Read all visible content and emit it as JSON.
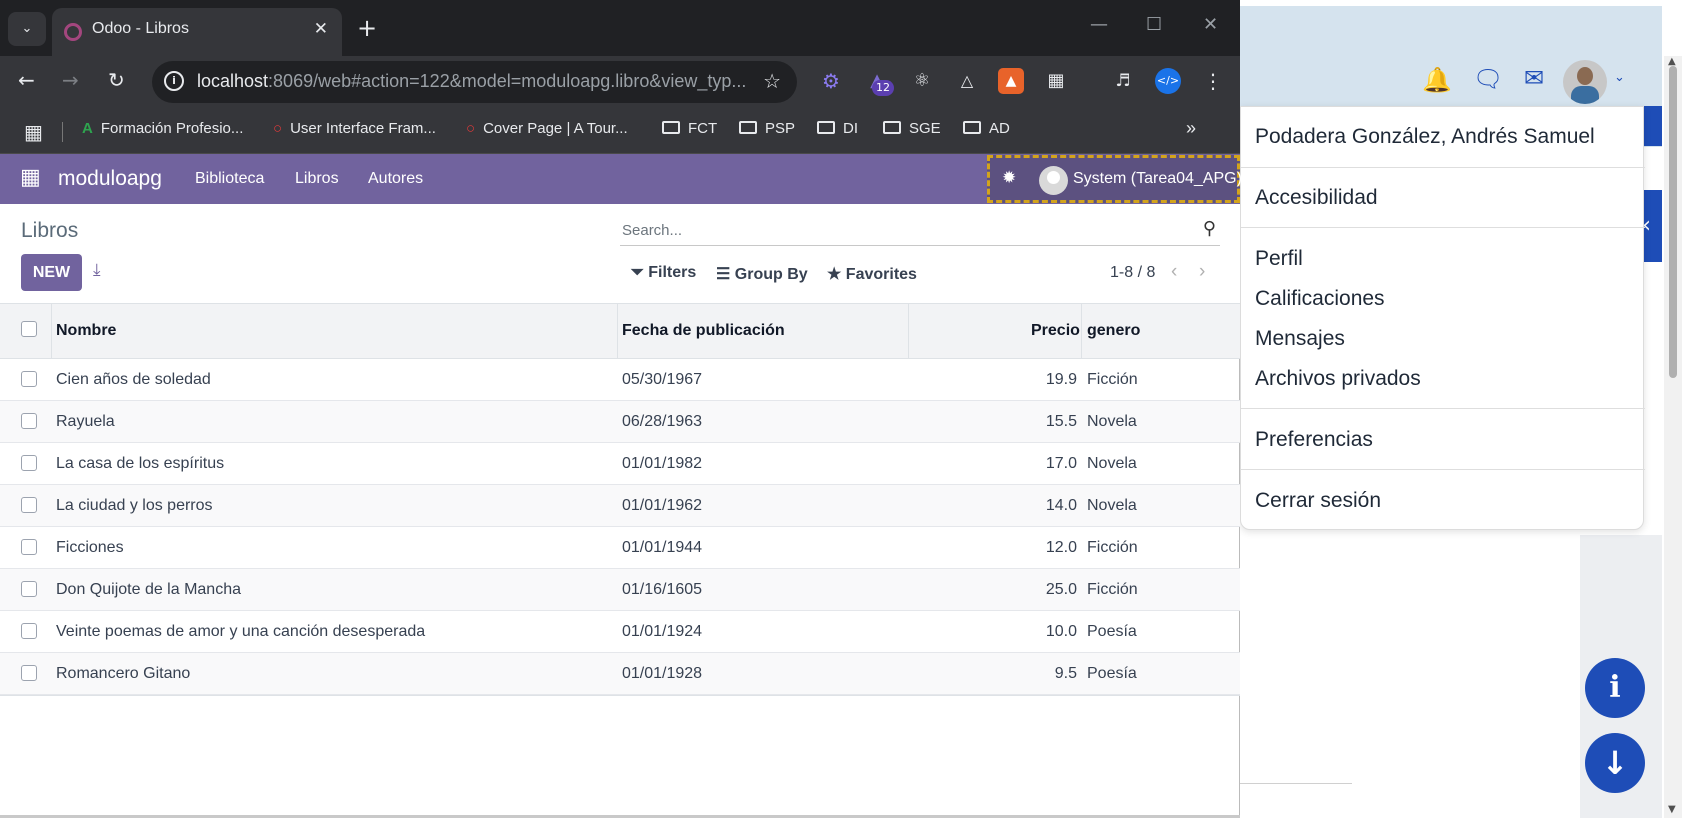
{
  "browser": {
    "tab_title": "Odoo - Libros",
    "url_host": "localhost",
    "url_rest": ":8069/web#action=122&model=moduloapg.libro&view_typ...",
    "extension_badge": "12",
    "bookmarks": [
      {
        "label": "Formación Profesio..."
      },
      {
        "label": "User Interface Fram..."
      },
      {
        "label": "Cover Page | A Tour..."
      },
      {
        "label": "FCT"
      },
      {
        "label": "PSP"
      },
      {
        "label": "DI"
      },
      {
        "label": "SGE"
      },
      {
        "label": "AD"
      }
    ]
  },
  "odoo": {
    "brand": "moduloapg",
    "menu": [
      "Biblioteca",
      "Libros",
      "Autores"
    ],
    "user": "System (Tarea04_APG)",
    "title": "Libros",
    "new_label": "NEW",
    "search_placeholder": "Search...",
    "filters": "Filters",
    "group_by": "Group By",
    "favorites": "Favorites",
    "pager": "1-8 / 8",
    "columns": {
      "nombre": "Nombre",
      "fecha": "Fecha de publicación",
      "precio": "Precio",
      "genero": "genero"
    },
    "rows": [
      {
        "nombre": "Cien años de soledad",
        "fecha": "05/30/1967",
        "precio": "19.9",
        "genero": "Ficción"
      },
      {
        "nombre": "Rayuela",
        "fecha": "06/28/1963",
        "precio": "15.5",
        "genero": "Novela"
      },
      {
        "nombre": "La casa de los espíritus",
        "fecha": "01/01/1982",
        "precio": "17.0",
        "genero": "Novela"
      },
      {
        "nombre": "La ciudad y los perros",
        "fecha": "01/01/1962",
        "precio": "14.0",
        "genero": "Novela"
      },
      {
        "nombre": "Ficciones",
        "fecha": "01/01/1944",
        "precio": "12.0",
        "genero": "Ficción"
      },
      {
        "nombre": "Don Quijote de la Mancha",
        "fecha": "01/16/1605",
        "precio": "25.0",
        "genero": "Ficción"
      },
      {
        "nombre": "Veinte poemas de amor y una canción desesperada",
        "fecha": "01/01/1924",
        "precio": "10.0",
        "genero": "Poesía"
      },
      {
        "nombre": "Romancero Gitano",
        "fecha": "01/01/1928",
        "precio": "9.5",
        "genero": "Poesía"
      }
    ]
  },
  "user_menu": {
    "name": "Podadera González, Andrés Samuel",
    "accesibilidad": "Accesibilidad",
    "perfil": "Perfil",
    "calificaciones": "Calificaciones",
    "mensajes": "Mensajes",
    "archivos": "Archivos privados",
    "preferencias": "Preferencias",
    "cerrar": "Cerrar sesión"
  },
  "colors": {
    "odoo_primary": "#71639e",
    "accent_blue": "#1e4db7",
    "chrome_dark": "#202124"
  }
}
